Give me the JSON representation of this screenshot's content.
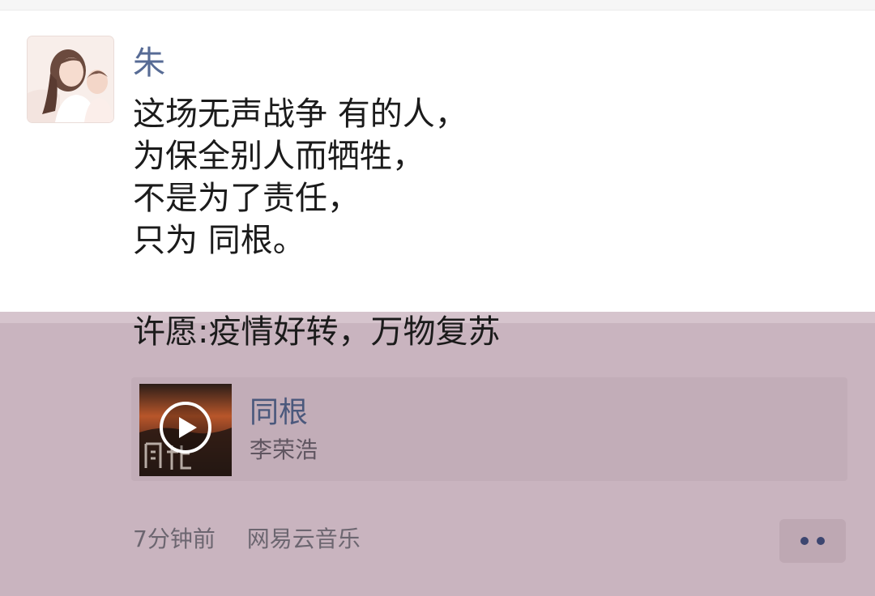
{
  "post": {
    "username": "朱",
    "avatar_icon": "profile-photo-icon",
    "lines": [
      "这场无声战争 有的人，",
      "为保全别人而牺牲，",
      "不是为了责任，",
      "只为 同根。"
    ],
    "wish": "许愿:疫情好转，万物复苏"
  },
  "music_card": {
    "cover_icon": "play-circle-icon",
    "title": "同根",
    "artist": "李荣浩"
  },
  "meta": {
    "timestamp": "7分钟前",
    "source": "网易云音乐"
  },
  "actions": {
    "more_icon": "more-dots-icon"
  },
  "colors": {
    "username": "#576b95",
    "overlay_tint": "#c9b4bf",
    "song_title": "#4a587c"
  }
}
